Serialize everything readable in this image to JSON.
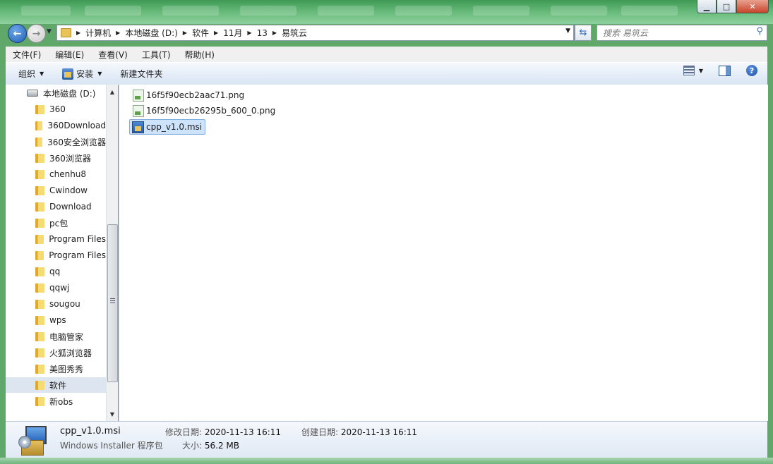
{
  "window": {
    "buttons": {
      "minimize": "▁",
      "maximize": "□",
      "close": "✕"
    }
  },
  "address": {
    "crumbs": [
      "计算机",
      "本地磁盘 (D:)",
      "软件",
      "11月",
      "13",
      "易筑云"
    ],
    "search_placeholder": "搜索 易筑云"
  },
  "menubar": {
    "items": [
      "文件(F)",
      "编辑(E)",
      "查看(V)",
      "工具(T)",
      "帮助(H)"
    ]
  },
  "toolbar": {
    "organize": "组织",
    "install": "安装",
    "new_folder": "新建文件夹"
  },
  "navpane": {
    "drive": "本地磁盘 (D:)",
    "folders": [
      "360",
      "360Download",
      "360安全浏览器",
      "360浏览器",
      "chenhu8",
      "Cwindow",
      "Download",
      "pc包",
      "Program Files",
      "Program Files",
      "qq",
      "qqwj",
      "sougou",
      "wps",
      "电脑管家",
      "火狐浏览器",
      "美图秀秀",
      "软件",
      "新obs"
    ],
    "selected_index": 17
  },
  "files": [
    {
      "name": "16f5f90ecb2aac71.png",
      "icon": "png-file-icon"
    },
    {
      "name": "16f5f90ecb26295b_600_0.png",
      "icon": "png-file-icon"
    },
    {
      "name": "cpp_v1.0.msi",
      "icon": "msi-file-icon",
      "selected": true
    }
  ],
  "details": {
    "name": "cpp_v1.0.msi",
    "type": "Windows Installer 程序包",
    "modified_label": "修改日期:",
    "modified_value": "2020-11-13 16:11",
    "created_label": "创建日期:",
    "created_value": "2020-11-13 16:11",
    "size_label": "大小:",
    "size_value": "56.2 MB"
  }
}
